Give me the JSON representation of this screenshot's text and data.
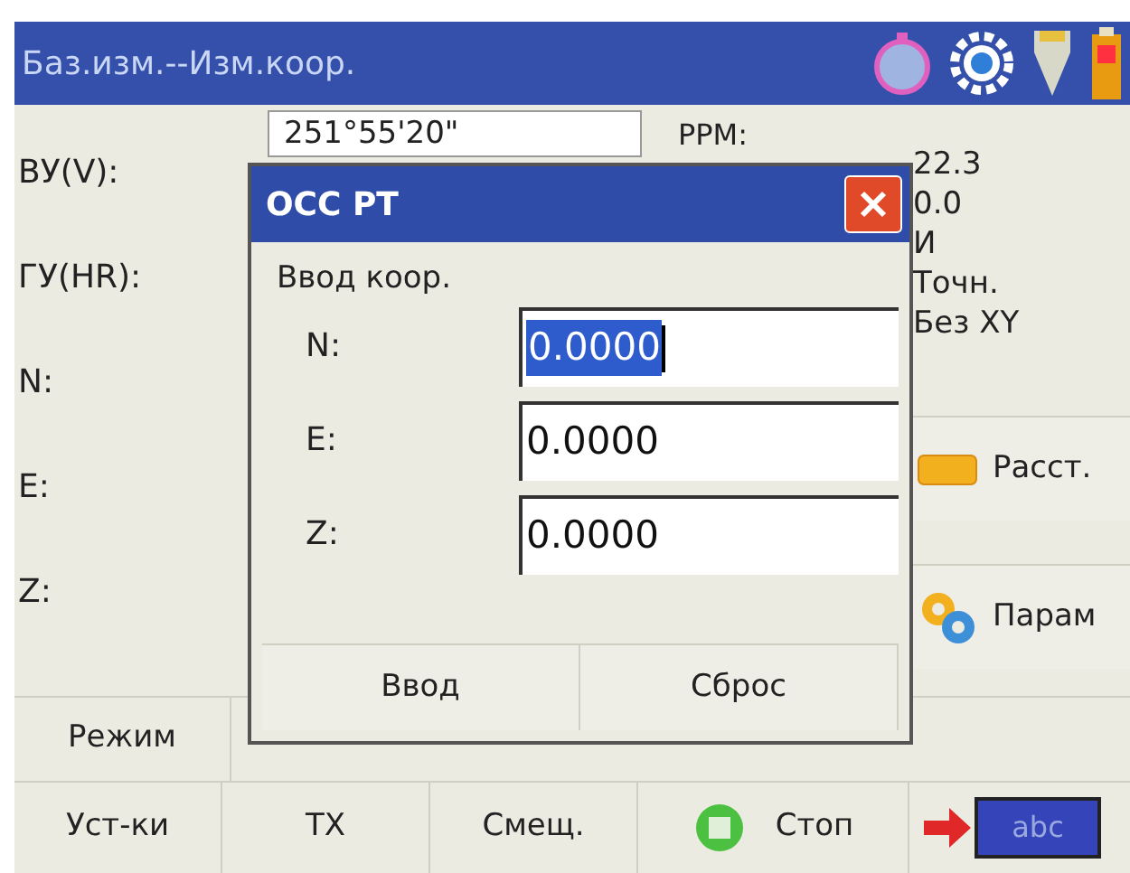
{
  "window": {
    "title": "Баз.изм.--Изм.коор."
  },
  "labels": [
    "ВУ(V):",
    "ГУ(HR):",
    "N:",
    "E:",
    "Z:"
  ],
  "angle_field": {
    "value": "251°55'20\""
  },
  "ppm_label": "PPM:",
  "status_values": [
    "22.3",
    "0.0",
    "И",
    "Точн.",
    "Без XY"
  ],
  "side_buttons": [
    {
      "label": "Расст.",
      "kind": "distance"
    },
    {
      "label": "Парам",
      "kind": "params"
    }
  ],
  "bottom_row_1": [
    "Режим"
  ],
  "bottom_row_2": [
    "Уст-ки",
    "ТХ",
    "Смещ."
  ],
  "stop_button": {
    "label": "Стоп"
  },
  "input_mode": {
    "label": "abc"
  },
  "dialog": {
    "title": "OCC PT",
    "section": "Ввод коор.",
    "fields": [
      {
        "label": "N:",
        "value": "0.0000",
        "selected": true
      },
      {
        "label": "E:",
        "value": "0.0000",
        "selected": false
      },
      {
        "label": "Z:",
        "value": "0.0000",
        "selected": false
      }
    ],
    "buttons": [
      "Ввод",
      "Сброс"
    ]
  }
}
